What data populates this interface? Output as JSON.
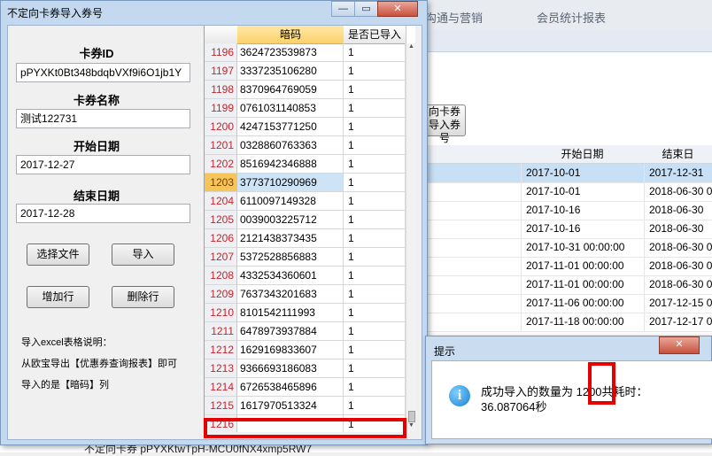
{
  "background_app": {
    "tabs": [
      "",
      "",
      "沟通与营销",
      "会员统计报表"
    ],
    "partial_button_label": "向卡券\n导入券号",
    "table": {
      "headers": [
        "",
        "开始日期",
        "结束日"
      ],
      "rows": [
        {
          "start": "2017-10-01",
          "end": "2017-12-31",
          "selected": true
        },
        {
          "start": "2017-10-01",
          "end": "2018-06-30 0"
        },
        {
          "start": "2017-10-16",
          "end": "2018-06-30"
        },
        {
          "start": "2017-10-16",
          "end": "2018-06-30"
        },
        {
          "start": "2017-10-31 00:00:00",
          "end": "2018-06-30 0"
        },
        {
          "start": "2017-11-01 00:00:00",
          "end": "2018-06-30 0"
        },
        {
          "start": "2017-11-01 00:00:00",
          "end": "2018-06-30 0"
        },
        {
          "start": "2017-11-06 00:00:00",
          "end": "2017-12-15 0"
        },
        {
          "start": "2017-11-18 00:00:00",
          "end": "2017-12-17 0"
        }
      ]
    },
    "bottom_row_text": "不定向卡券          pPYXKtwTpH-MCU0fNX4xmp5RW7"
  },
  "dialog": {
    "title": "不定向卡券导入券号",
    "fields": {
      "card_id_label": "卡券ID",
      "card_id_value": "pPYXKt0Bt348bdqbVXf9i6O1jb1Y",
      "card_name_label": "卡券名称",
      "card_name_value": "测试122731",
      "start_date_label": "开始日期",
      "start_date_value": "2017-12-27",
      "end_date_label": "结束日期",
      "end_date_value": "2017-12-28"
    },
    "buttons": {
      "choose_file": "选择文件",
      "import": "导入",
      "add_row": "增加行",
      "delete_row": "删除行"
    },
    "notes": [
      "导入excel表格说明：",
      "从欧宝导出【优惠券查询报表】即可",
      "导入的是【暗码】列"
    ],
    "grid": {
      "headers": [
        "暗码",
        "是否已导入"
      ],
      "current_row": "1203",
      "rows": [
        {
          "num": "1196",
          "code": "3624723539873",
          "imported": "1"
        },
        {
          "num": "1197",
          "code": "3337235106280",
          "imported": "1"
        },
        {
          "num": "1198",
          "code": "8370964769059",
          "imported": "1"
        },
        {
          "num": "1199",
          "code": "0761031140853",
          "imported": "1"
        },
        {
          "num": "1200",
          "code": "4247153771250",
          "imported": "1"
        },
        {
          "num": "1201",
          "code": "0328860763363",
          "imported": "1"
        },
        {
          "num": "1202",
          "code": "8516942346888",
          "imported": "1"
        },
        {
          "num": "1203",
          "code": "3773710290969",
          "imported": "1"
        },
        {
          "num": "1204",
          "code": "6110097149328",
          "imported": "1"
        },
        {
          "num": "1205",
          "code": "0039003225712",
          "imported": "1"
        },
        {
          "num": "1206",
          "code": "2121438373435",
          "imported": "1"
        },
        {
          "num": "1207",
          "code": "5372528856883",
          "imported": "1"
        },
        {
          "num": "1208",
          "code": "4332534360601",
          "imported": "1"
        },
        {
          "num": "1209",
          "code": "7637343201683",
          "imported": "1"
        },
        {
          "num": "1210",
          "code": "8101542111993",
          "imported": "1"
        },
        {
          "num": "1211",
          "code": "6478973937884",
          "imported": "1"
        },
        {
          "num": "1212",
          "code": "1629169833607",
          "imported": "1"
        },
        {
          "num": "1213",
          "code": "9366693186083",
          "imported": "1"
        },
        {
          "num": "1214",
          "code": "6726538465896",
          "imported": "1"
        },
        {
          "num": "1215",
          "code": "1617970513324",
          "imported": "1"
        },
        {
          "num": "1216",
          "code": "",
          "imported": "1"
        }
      ]
    }
  },
  "message_box": {
    "title": "提示",
    "line1": "成功导入的数量为 1200共耗时：",
    "line2": "36.087064秒",
    "close_label": "✕"
  },
  "colors": {
    "highlight": "#e40000",
    "row_number": "#c0262c",
    "current_row_bg": "#f6c55a",
    "header_active": "#fbd26b"
  }
}
